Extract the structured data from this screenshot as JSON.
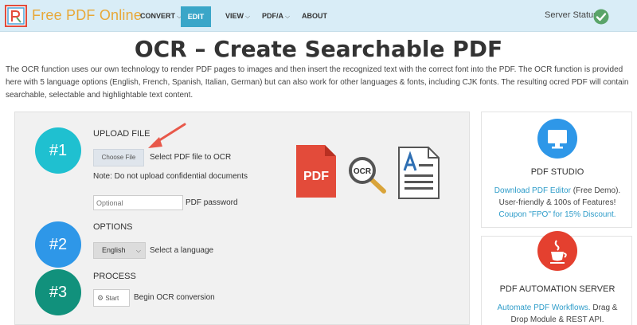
{
  "header": {
    "brand": "Free PDF Online",
    "nav": {
      "convert": "CONVERT",
      "edit": "EDIT",
      "view": "VIEW",
      "pdfa": "PDF/A",
      "about": "ABOUT"
    },
    "server_status_label": "Server Status:"
  },
  "page": {
    "title": "OCR – Create Searchable PDF",
    "intro": "The OCR function uses our own technology to render PDF pages to images and then insert the recognized text with the correct font into the PDF. The OCR function is provided here with 5 language options (English, French, Spanish, Italian, German) but can also work for other languages & fonts, including CJK fonts. The resulting ocred PDF will contain searchable, selectable and highlightable text content."
  },
  "steps": {
    "upload": {
      "number": "#1",
      "title": "UPLOAD FILE",
      "choose_file_label": "Choose File",
      "select_hint": "Select PDF file to OCR",
      "note": "Note: Do not upload confidential documents",
      "password_placeholder": "Optional",
      "password_label": "PDF password"
    },
    "options": {
      "number": "#2",
      "title": "OPTIONS",
      "language_value": "English",
      "language_hint": "Select a language"
    },
    "process": {
      "number": "#3",
      "title": "PROCESS",
      "start_label": "Start",
      "start_hint": "Begin OCR conversion"
    }
  },
  "illustration": {
    "pdf_label": "PDF",
    "ocr_label": "OCR"
  },
  "sidebar": {
    "studio": {
      "title": "PDF STUDIO",
      "link": "Download PDF Editor",
      "text_after_link": " (Free Demo). User-friendly & 100s of Features! ",
      "coupon_link": "Coupon \"FPO\" for 15% Discount.",
      "icon": "monitor-icon",
      "icon_color": "#2e97e8"
    },
    "automation": {
      "title": "PDF AUTOMATION SERVER",
      "link": "Automate PDF Workflows.",
      "text_after_link": " Drag & Drop Module & REST API.",
      "icon": "java-cup-icon",
      "icon_color": "#e4402f"
    }
  },
  "colors": {
    "header_bg": "#d9edf7",
    "accent": "#3aa6c8",
    "step1": "#1fc0d0",
    "step2": "#2e97e8",
    "step3": "#11917c",
    "arrow": "#e8584a",
    "status_ok": "#5aa469"
  }
}
